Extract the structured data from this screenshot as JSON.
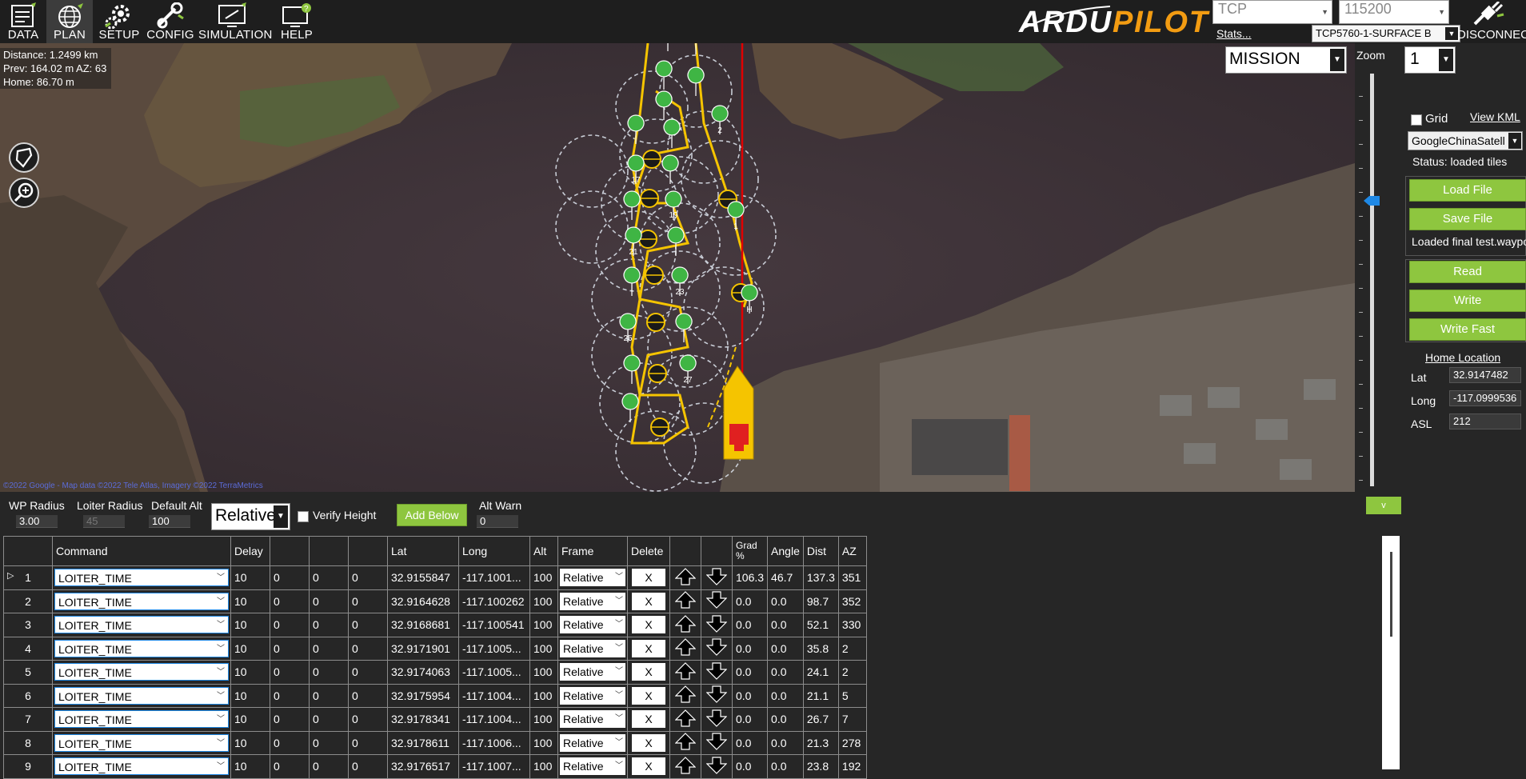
{
  "nav": {
    "items": [
      {
        "label": "DATA",
        "icon": "data-icon"
      },
      {
        "label": "PLAN",
        "icon": "plan-globe-icon"
      },
      {
        "label": "SETUP",
        "icon": "setup-icon"
      },
      {
        "label": "CONFIG",
        "icon": "config-icon"
      },
      {
        "label": "SIMULATION",
        "icon": "simulation-icon"
      },
      {
        "label": "HELP",
        "icon": "help-icon"
      }
    ],
    "logo_text": "ARDUPILOT",
    "connection_type": "TCP",
    "baud": "115200",
    "stats_link": "Stats...",
    "connection_name": "TCP5760-1-SURFACE B",
    "disconnect_label": "DISCONNECT"
  },
  "map": {
    "distance": "Distance: 1.2499 km",
    "prev": "Prev: 164.02 m AZ: 63",
    "home": "Home: 86.70 m",
    "copyright": "©2022 Google - Map data ©2022 Tele Atlas, Imagery ©2022 TerraMetrics",
    "mode": "MISSION",
    "waypoint_labels": [
      "1",
      "19",
      "21",
      "23",
      "25",
      "27",
      "H",
      "2",
      "17"
    ]
  },
  "side": {
    "zoom_label": "Zoom",
    "zoom_value": "1",
    "grid_label": "Grid",
    "view_kml": "View KML",
    "map_provider": "GoogleChinaSatell",
    "status": "Status: loaded tiles",
    "load_file": "Load File",
    "save_file": "Save File",
    "loaded_msg": "Loaded final test.waypo",
    "read": "Read",
    "write": "Write",
    "write_fast": "Write Fast",
    "home_location": "Home Location",
    "lat_label": "Lat",
    "lat": "32.9147482",
    "long_label": "Long",
    "long": "-117.0999536",
    "asl_label": "ASL",
    "asl": "212"
  },
  "controls": {
    "wp_radius_label": "WP Radius",
    "wp_radius": "3.00",
    "loiter_radius_label": "Loiter Radius",
    "loiter_radius": "45",
    "default_alt_label": "Default Alt",
    "default_alt": "100",
    "alt_frame": "Relative",
    "verify_height": "Verify Height",
    "add_below": "Add Below",
    "alt_warn_label": "Alt Warn",
    "alt_warn": "0",
    "collapse": "v"
  },
  "table": {
    "headers": [
      "",
      "Command",
      "Delay",
      "",
      "",
      "",
      "Lat",
      "Long",
      "Alt",
      "Frame",
      "Delete",
      "",
      "",
      "Grad %",
      "Angle",
      "Dist",
      "AZ"
    ],
    "rows": [
      {
        "n": "1",
        "cmd": "LOITER_TIME",
        "delay": "10",
        "p2": "0",
        "p3": "0",
        "p4": "0",
        "lat": "32.9155847",
        "lon": "-117.1001...",
        "alt": "100",
        "frame": "Relative",
        "del": "X",
        "grad": "106.3",
        "angle": "46.7",
        "dist": "137.3",
        "az": "351"
      },
      {
        "n": "2",
        "cmd": "LOITER_TIME",
        "delay": "10",
        "p2": "0",
        "p3": "0",
        "p4": "0",
        "lat": "32.9164628",
        "lon": "-117.100262",
        "alt": "100",
        "frame": "Relative",
        "del": "X",
        "grad": "0.0",
        "angle": "0.0",
        "dist": "98.7",
        "az": "352"
      },
      {
        "n": "3",
        "cmd": "LOITER_TIME",
        "delay": "10",
        "p2": "0",
        "p3": "0",
        "p4": "0",
        "lat": "32.9168681",
        "lon": "-117.100541",
        "alt": "100",
        "frame": "Relative",
        "del": "X",
        "grad": "0.0",
        "angle": "0.0",
        "dist": "52.1",
        "az": "330"
      },
      {
        "n": "4",
        "cmd": "LOITER_TIME",
        "delay": "10",
        "p2": "0",
        "p3": "0",
        "p4": "0",
        "lat": "32.9171901",
        "lon": "-117.1005...",
        "alt": "100",
        "frame": "Relative",
        "del": "X",
        "grad": "0.0",
        "angle": "0.0",
        "dist": "35.8",
        "az": "2"
      },
      {
        "n": "5",
        "cmd": "LOITER_TIME",
        "delay": "10",
        "p2": "0",
        "p3": "0",
        "p4": "0",
        "lat": "32.9174063",
        "lon": "-117.1005...",
        "alt": "100",
        "frame": "Relative",
        "del": "X",
        "grad": "0.0",
        "angle": "0.0",
        "dist": "24.1",
        "az": "2"
      },
      {
        "n": "6",
        "cmd": "LOITER_TIME",
        "delay": "10",
        "p2": "0",
        "p3": "0",
        "p4": "0",
        "lat": "32.9175954",
        "lon": "-117.1004...",
        "alt": "100",
        "frame": "Relative",
        "del": "X",
        "grad": "0.0",
        "angle": "0.0",
        "dist": "21.1",
        "az": "5"
      },
      {
        "n": "7",
        "cmd": "LOITER_TIME",
        "delay": "10",
        "p2": "0",
        "p3": "0",
        "p4": "0",
        "lat": "32.9178341",
        "lon": "-117.1004...",
        "alt": "100",
        "frame": "Relative",
        "del": "X",
        "grad": "0.0",
        "angle": "0.0",
        "dist": "26.7",
        "az": "7"
      },
      {
        "n": "8",
        "cmd": "LOITER_TIME",
        "delay": "10",
        "p2": "0",
        "p3": "0",
        "p4": "0",
        "lat": "32.9178611",
        "lon": "-117.1006...",
        "alt": "100",
        "frame": "Relative",
        "del": "X",
        "grad": "0.0",
        "angle": "0.0",
        "dist": "21.3",
        "az": "278"
      },
      {
        "n": "9",
        "cmd": "LOITER_TIME",
        "delay": "10",
        "p2": "0",
        "p3": "0",
        "p4": "0",
        "lat": "32.9176517",
        "lon": "-117.1007...",
        "alt": "100",
        "frame": "Relative",
        "del": "X",
        "grad": "0.0",
        "angle": "0.0",
        "dist": "23.8",
        "az": "192"
      }
    ]
  },
  "colors": {
    "accent_green": "#8ec63f",
    "waypoint_green": "#3fb544",
    "route_yellow": "#f5c400",
    "track_red": "#e00000",
    "slider_blue": "#1e88e5"
  }
}
